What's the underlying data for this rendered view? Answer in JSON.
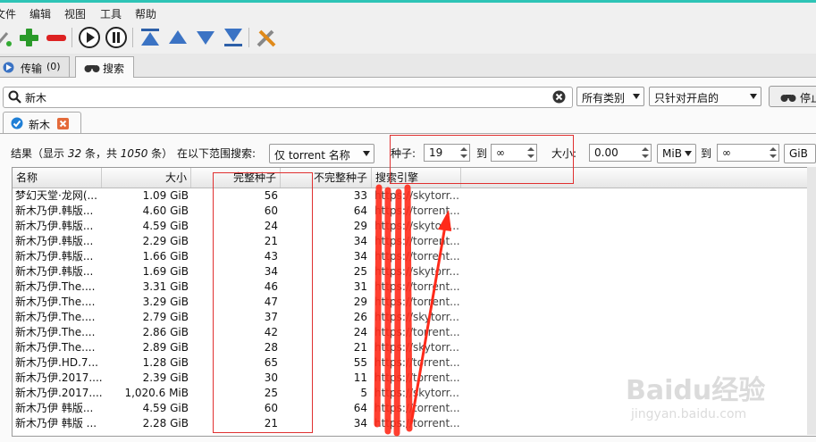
{
  "menu": [
    "文件",
    "编辑",
    "视图",
    "工具",
    "帮助"
  ],
  "tabs": [
    {
      "label": "传输",
      "count": "(0)"
    },
    {
      "label": "搜索"
    }
  ],
  "search": {
    "query": "新木",
    "category": "所有类别",
    "scope": "只针对开启的",
    "stop_label": "停止"
  },
  "subtab": {
    "label": "新木"
  },
  "filter": {
    "results_prefix": "结果（显示",
    "shown": "32",
    "results_mid": "条，共",
    "total": "1050",
    "results_suffix": "条）",
    "range_label": "在以下范围搜索:",
    "range_value": "仅 torrent 名称",
    "seeds_label": "种子:",
    "seeds_min": "19",
    "to1": "到",
    "seeds_max": "∞",
    "size_label": "大小:",
    "size_min": "0.00",
    "size_unit_min": "MiB",
    "to2": "到",
    "size_max": "∞",
    "size_unit_max": "GiB"
  },
  "table": {
    "columns": [
      "名称",
      "大小",
      "完整种子",
      "不完整种子",
      "搜索引擎"
    ],
    "rows": [
      [
        "梦幻天堂·龙网(...",
        "1.09 GiB",
        "56",
        "33",
        "https://skytorr..."
      ],
      [
        "新木乃伊.韩版...",
        "4.60 GiB",
        "60",
        "64",
        "https://torrent..."
      ],
      [
        "新木乃伊.韩版...",
        "4.59 GiB",
        "24",
        "29",
        "https://skytorr..."
      ],
      [
        "新木乃伊.韩版...",
        "2.29 GiB",
        "21",
        "34",
        "https://torrent..."
      ],
      [
        "新木乃伊.韩版...",
        "1.66 GiB",
        "43",
        "34",
        "https://torrent..."
      ],
      [
        "新木乃伊.韩版...",
        "1.69 GiB",
        "34",
        "25",
        "https://skytorr..."
      ],
      [
        "新木乃伊.The....",
        "3.31 GiB",
        "46",
        "31",
        "https://torrent..."
      ],
      [
        "新木乃伊.The....",
        "3.29 GiB",
        "47",
        "29",
        "https://torrent..."
      ],
      [
        "新木乃伊.The....",
        "2.79 GiB",
        "37",
        "26",
        "https://skytorr..."
      ],
      [
        "新木乃伊.The....",
        "2.86 GiB",
        "42",
        "24",
        "https://torrent..."
      ],
      [
        "新木乃伊.The....",
        "2.89 GiB",
        "28",
        "21",
        "https://skytorr..."
      ],
      [
        "新木乃伊.HD.7...",
        "1.28 GiB",
        "65",
        "55",
        "https://torrent..."
      ],
      [
        "新木乃伊.2017....",
        "2.39 GiB",
        "30",
        "11",
        "https://torrent..."
      ],
      [
        "新木乃伊.2017....",
        "1,020.6 MiB",
        "25",
        "5",
        "https://skytorr..."
      ],
      [
        "新木乃伊 韩版...",
        "4.59 GiB",
        "60",
        "64",
        "https://torrent..."
      ],
      [
        "新木乃伊 韩版 ...",
        "2.28 GiB",
        "21",
        "34",
        "https://torrent..."
      ]
    ]
  },
  "watermark": {
    "brand": "Baidu经验",
    "url": "jingyan.baidu.com"
  },
  "colors": {
    "annotation": "#e03030",
    "accent_teal": "#2ec4b6"
  }
}
